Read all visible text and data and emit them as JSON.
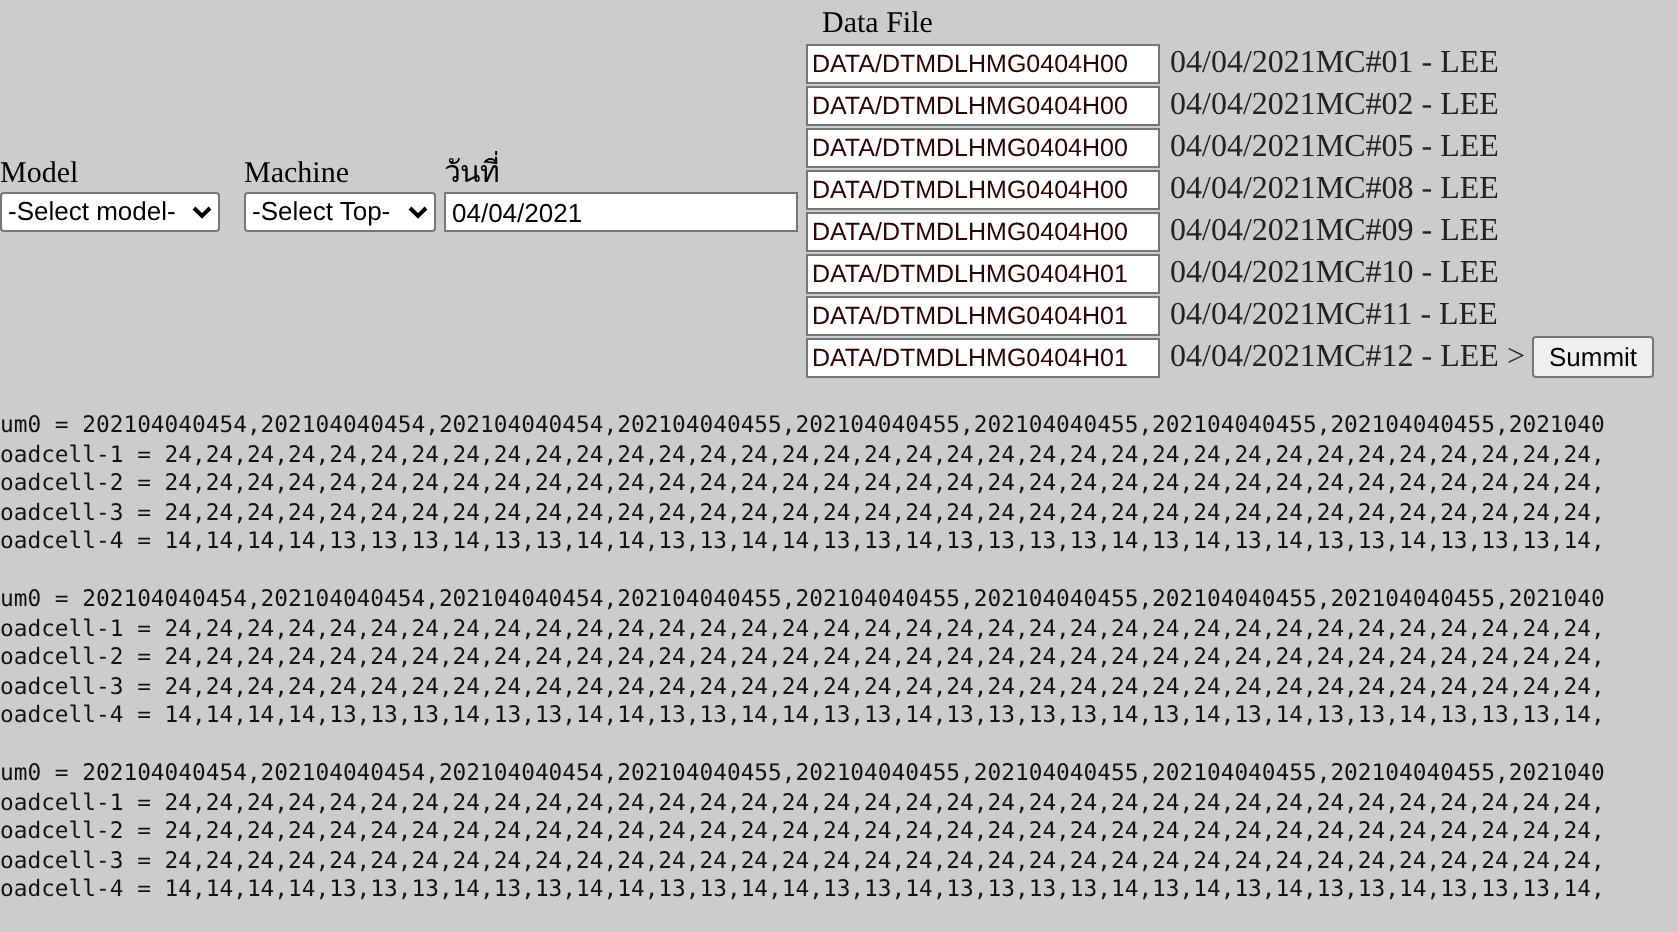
{
  "form": {
    "model": {
      "label": "Model",
      "value": "-Select model-"
    },
    "machine": {
      "label": "Machine",
      "value": "-Select Top-"
    },
    "date": {
      "label": "วันที่",
      "value": "04/04/2021"
    },
    "data_file": {
      "label": "Data File",
      "files": [
        {
          "path": "DATA/DTMDLHMG0404H00",
          "caption": "04/04/2021MC#01 - LEE"
        },
        {
          "path": "DATA/DTMDLHMG0404H00",
          "caption": "04/04/2021MC#02 - LEE"
        },
        {
          "path": "DATA/DTMDLHMG0404H00",
          "caption": "04/04/2021MC#05 - LEE"
        },
        {
          "path": "DATA/DTMDLHMG0404H00",
          "caption": "04/04/2021MC#08 - LEE"
        },
        {
          "path": "DATA/DTMDLHMG0404H00",
          "caption": "04/04/2021MC#09 - LEE"
        },
        {
          "path": "DATA/DTMDLHMG0404H01",
          "caption": "04/04/2021MC#10 - LEE"
        },
        {
          "path": "DATA/DTMDLHMG0404H01",
          "caption": "04/04/2021MC#11 - LEE"
        },
        {
          "path": "DATA/DTMDLHMG0404H01",
          "caption": "04/04/2021MC#12 - LEE >"
        }
      ],
      "submit": "Summit"
    }
  },
  "blocks": [
    {
      "lines": [
        "um0 = 202104040454,202104040454,202104040454,202104040455,202104040455,202104040455,202104040455,202104040455,2021040",
        "oadcell-1 = 24,24,24,24,24,24,24,24,24,24,24,24,24,24,24,24,24,24,24,24,24,24,24,24,24,24,24,24,24,24,24,24,24,24,24,",
        "oadcell-2 = 24,24,24,24,24,24,24,24,24,24,24,24,24,24,24,24,24,24,24,24,24,24,24,24,24,24,24,24,24,24,24,24,24,24,24,",
        "oadcell-3 = 24,24,24,24,24,24,24,24,24,24,24,24,24,24,24,24,24,24,24,24,24,24,24,24,24,24,24,24,24,24,24,24,24,24,24,",
        "oadcell-4 = 14,14,14,14,13,13,13,14,13,13,14,14,13,13,14,14,13,13,14,13,13,13,13,14,13,14,13,14,13,13,14,13,13,13,14,"
      ]
    },
    {
      "lines": [
        "um0 = 202104040454,202104040454,202104040454,202104040455,202104040455,202104040455,202104040455,202104040455,2021040",
        "oadcell-1 = 24,24,24,24,24,24,24,24,24,24,24,24,24,24,24,24,24,24,24,24,24,24,24,24,24,24,24,24,24,24,24,24,24,24,24,",
        "oadcell-2 = 24,24,24,24,24,24,24,24,24,24,24,24,24,24,24,24,24,24,24,24,24,24,24,24,24,24,24,24,24,24,24,24,24,24,24,",
        "oadcell-3 = 24,24,24,24,24,24,24,24,24,24,24,24,24,24,24,24,24,24,24,24,24,24,24,24,24,24,24,24,24,24,24,24,24,24,24,",
        "oadcell-4 = 14,14,14,14,13,13,13,14,13,13,14,14,13,13,14,14,13,13,14,13,13,13,13,14,13,14,13,14,13,13,14,13,13,13,14,"
      ]
    },
    {
      "lines": [
        "um0 = 202104040454,202104040454,202104040454,202104040455,202104040455,202104040455,202104040455,202104040455,2021040",
        "oadcell-1 = 24,24,24,24,24,24,24,24,24,24,24,24,24,24,24,24,24,24,24,24,24,24,24,24,24,24,24,24,24,24,24,24,24,24,24,",
        "oadcell-2 = 24,24,24,24,24,24,24,24,24,24,24,24,24,24,24,24,24,24,24,24,24,24,24,24,24,24,24,24,24,24,24,24,24,24,24,",
        "oadcell-3 = 24,24,24,24,24,24,24,24,24,24,24,24,24,24,24,24,24,24,24,24,24,24,24,24,24,24,24,24,24,24,24,24,24,24,24,",
        "oadcell-4 = 14,14,14,14,13,13,13,14,13,13,14,14,13,13,14,14,13,13,14,13,13,13,13,14,13,14,13,14,13,13,14,13,13,13,14,"
      ]
    }
  ]
}
